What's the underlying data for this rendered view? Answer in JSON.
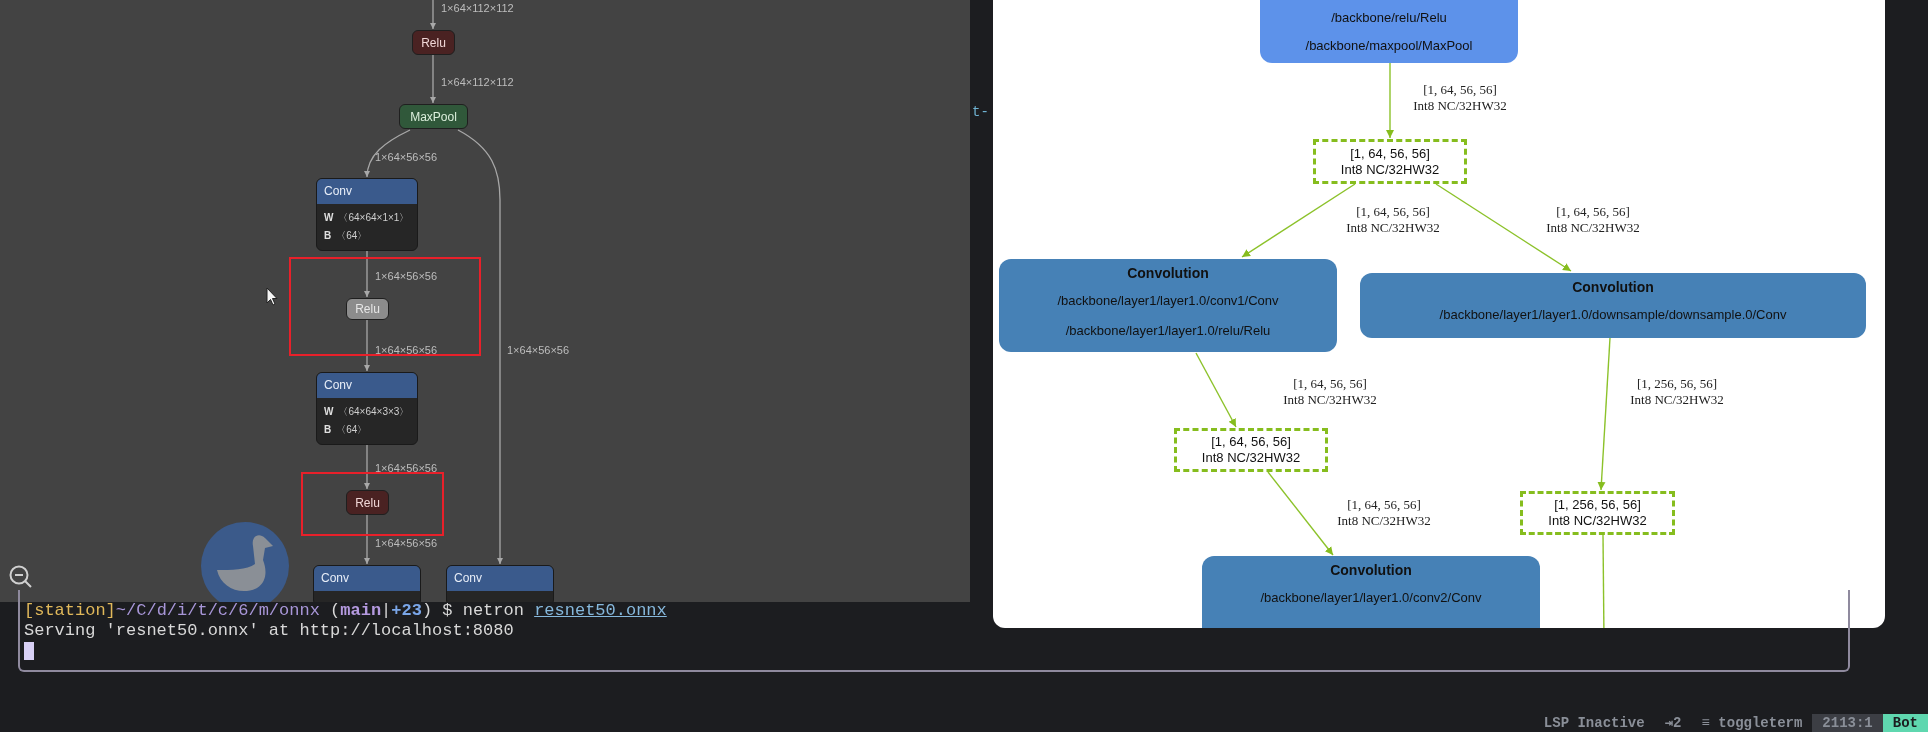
{
  "netron": {
    "nodes": [
      {
        "kind": "activation",
        "label": "Relu",
        "selected": false,
        "highlighted": false
      },
      {
        "kind": "pool",
        "label": "MaxPool",
        "selected": false,
        "highlighted": false
      },
      {
        "kind": "layer",
        "label": "Conv",
        "selected": false,
        "highlighted": false,
        "attributes": [
          {
            "name": "W",
            "value": "〈64×64×1×1〉"
          },
          {
            "name": "B",
            "value": "〈64〉"
          }
        ]
      },
      {
        "kind": "activation",
        "label": "Relu",
        "selected": true,
        "highlighted": true
      },
      {
        "kind": "layer",
        "label": "Conv",
        "selected": false,
        "highlighted": false,
        "attributes": [
          {
            "name": "W",
            "value": "〈64×64×3×3〉"
          },
          {
            "name": "B",
            "value": "〈64〉"
          }
        ]
      },
      {
        "kind": "activation",
        "label": "Relu",
        "selected": false,
        "highlighted": true
      },
      {
        "kind": "layer",
        "label": "Conv",
        "selected": false,
        "highlighted": false
      },
      {
        "kind": "layer",
        "label": "Conv",
        "selected": false,
        "highlighted": false
      }
    ],
    "edge_labels": [
      "1×64×112×112",
      "1×64×112×112",
      "1×64×56×56",
      "1×64×56×56",
      "1×64×56×56",
      "1×64×56×56",
      "1×64×56×56",
      "1×64×56×56"
    ]
  },
  "background_text": "t-",
  "engine_graph": {
    "nodes": [
      {
        "kind": "layer",
        "lines": [
          "/backbone/relu/Relu",
          "/backbone/maxpool/MaxPool"
        ]
      },
      {
        "kind": "tensor",
        "lines": [
          "[1, 64, 56, 56]",
          "Int8 NC/32HW32"
        ]
      },
      {
        "kind": "layer",
        "title": "Convolution",
        "lines": [
          "/backbone/layer1/layer1.0/conv1/Conv",
          "/backbone/layer1/layer1.0/relu/Relu"
        ]
      },
      {
        "kind": "layer",
        "title": "Convolution",
        "lines": [
          "/backbone/layer1/layer1.0/downsample/downsample.0/Conv"
        ]
      },
      {
        "kind": "tensor",
        "lines": [
          "[1, 64, 56, 56]",
          "Int8 NC/32HW32"
        ]
      },
      {
        "kind": "tensor",
        "lines": [
          "[1, 256, 56, 56]",
          "Int8 NC/32HW32"
        ]
      },
      {
        "kind": "layer",
        "title": "Convolution",
        "lines": [
          "/backbone/layer1/layer1.0/conv2/Conv"
        ]
      }
    ],
    "edge_labels": [
      {
        "lines": [
          "[1, 64, 56, 56]",
          "Int8 NC/32HW32"
        ]
      },
      {
        "lines": [
          "[1, 64, 56, 56]",
          "Int8 NC/32HW32"
        ]
      },
      {
        "lines": [
          "[1, 64, 56, 56]",
          "Int8 NC/32HW32"
        ]
      },
      {
        "lines": [
          "[1, 64, 56, 56]",
          "Int8 NC/32HW32"
        ]
      },
      {
        "lines": [
          "[1, 256, 56, 56]",
          "Int8 NC/32HW32"
        ]
      },
      {
        "lines": [
          "[1, 64, 56, 56]",
          "Int8 NC/32HW32"
        ]
      }
    ]
  },
  "terminal": {
    "cursor": true,
    "lines": [
      {
        "segments": [
          {
            "kind": "host",
            "text": "[station]"
          },
          {
            "kind": "path",
            "text": "~/C/d/i/t/c/6/m/onnx"
          },
          {
            "kind": "plain",
            "text": " ("
          },
          {
            "kind": "branch",
            "text": "main"
          },
          {
            "kind": "plain",
            "text": "|"
          },
          {
            "kind": "status",
            "text": "+23"
          },
          {
            "kind": "plain",
            "text": ") $ netron "
          },
          {
            "kind": "link",
            "text": "resnet50.onnx"
          }
        ]
      },
      {
        "segments": [
          {
            "kind": "plain",
            "text": "Serving 'resnet50.onnx' at http://localhost:8080"
          }
        ]
      }
    ]
  },
  "status_bar": [
    {
      "kind": "plain",
      "text": "LSP Inactive"
    },
    {
      "kind": "plain",
      "text": "⇥2"
    },
    {
      "kind": "plain",
      "text": "≡ toggleterm"
    },
    {
      "kind": "position",
      "text": "2113:1"
    },
    {
      "kind": "scroll",
      "text": "Bot"
    }
  ]
}
